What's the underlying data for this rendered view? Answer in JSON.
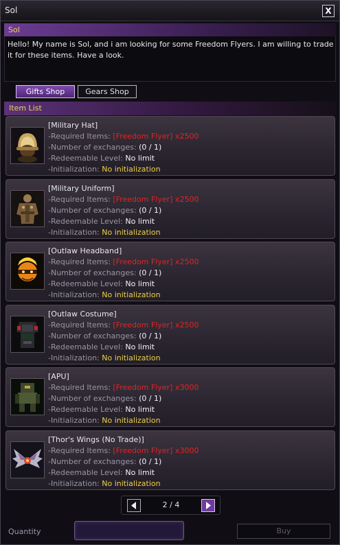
{
  "window": {
    "title": "Sol",
    "close_glyph": "X"
  },
  "npc": {
    "name": "Sol",
    "message": "Hello! My name is Sol, and i am looking for some Freedom Flyers. I am willing to trade it for these items. Have a look."
  },
  "tabs": [
    {
      "label": "Gifts Shop",
      "active": true
    },
    {
      "label": "Gears Shop",
      "active": false
    }
  ],
  "list_header": "Item List",
  "field_labels": {
    "required": "-Required Items:",
    "exchanges": "-Number of exchanges:",
    "level": "-Redeemable Level:",
    "init": "-Initialization:"
  },
  "items": [
    {
      "name": "[Military Hat]",
      "required": "[Freedom Flyer] x2500",
      "exchanges": "(0 / 1)",
      "level": "No limit",
      "init": "No initialization",
      "icon": "military-hat-icon"
    },
    {
      "name": "[Military Uniform]",
      "required": "[Freedom Flyer] x2500",
      "exchanges": "(0 / 1)",
      "level": "No limit",
      "init": "No initialization",
      "icon": "military-uniform-icon"
    },
    {
      "name": "[Outlaw Headband]",
      "required": "[Freedom Flyer] x2500",
      "exchanges": "(0 / 1)",
      "level": "No limit",
      "init": "No initialization",
      "icon": "outlaw-headband-icon"
    },
    {
      "name": "[Outlaw Costume]",
      "required": "[Freedom Flyer] x2500",
      "exchanges": "(0 / 1)",
      "level": "No limit",
      "init": "No initialization",
      "icon": "outlaw-costume-icon"
    },
    {
      "name": "[APU]",
      "required": "[Freedom Flyer] x3000",
      "exchanges": "(0 / 1)",
      "level": "No limit",
      "init": "No initialization",
      "icon": "apu-icon"
    },
    {
      "name": "[Thor's Wings (No Trade)]",
      "required": "[Freedom Flyer] x3000",
      "exchanges": "(0 / 1)",
      "level": "No limit",
      "init": "No initialization",
      "icon": "thors-wings-icon"
    }
  ],
  "pagination": {
    "text": "2 / 4",
    "current": 2,
    "total": 4
  },
  "quantity": {
    "label": "Quantity",
    "value": ""
  },
  "buy": {
    "label": "Buy",
    "enabled": false
  },
  "colors": {
    "accent_purple": "#6c3c92",
    "header_gold": "#f2cf56",
    "required_red": "#e02424",
    "init_yellow": "#eecf4a"
  }
}
